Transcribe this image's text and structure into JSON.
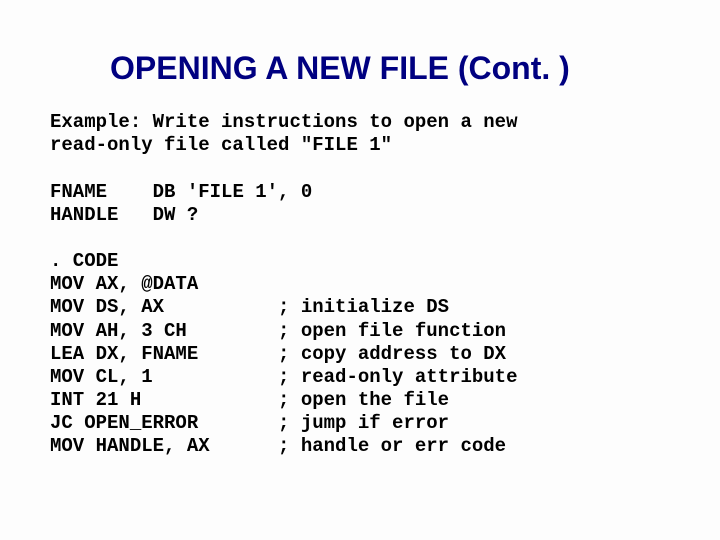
{
  "title": "OPENING A NEW FILE (Cont. )",
  "example_text": "Example: Write instructions to open a new\nread-only file called \"FILE 1\"",
  "defs": [
    {
      "label": "FNAME",
      "op": "DB 'FILE 1', 0"
    },
    {
      "label": "HANDLE",
      "op": "DW ?"
    }
  ],
  "code": [
    {
      "text": ". CODE",
      "comment": ""
    },
    {
      "text": "MOV AX, @DATA",
      "comment": ""
    },
    {
      "text": "MOV DS, AX",
      "comment": "; initialize DS"
    },
    {
      "text": "MOV AH, 3 CH",
      "comment": "; open file function"
    },
    {
      "text": "LEA DX, FNAME",
      "comment": "; copy address to DX"
    },
    {
      "text": "MOV CL, 1",
      "comment": "; read-only attribute"
    },
    {
      "text": "INT 21 H",
      "comment": "; open the file"
    },
    {
      "text": "JC OPEN_ERROR",
      "comment": "; jump if error"
    },
    {
      "text": "MOV HANDLE, AX",
      "comment": "; handle or err code"
    }
  ]
}
